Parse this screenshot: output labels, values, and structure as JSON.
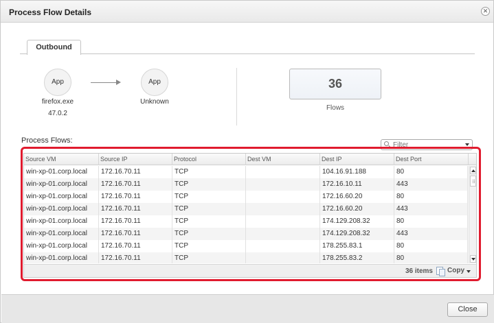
{
  "dialog": {
    "title": "Process Flow Details",
    "close_icon": "close-x-icon"
  },
  "tabs": [
    {
      "label": "Outbound",
      "selected": true
    }
  ],
  "flow": {
    "source": {
      "icon_label": "App",
      "name": "firefox.exe",
      "version": "47.0.2"
    },
    "destination": {
      "icon_label": "App",
      "name": "Unknown"
    }
  },
  "flows_summary": {
    "count": "36",
    "label": "Flows"
  },
  "process_flows": {
    "label": "Process Flows:",
    "filter_placeholder": "Filter",
    "columns": [
      "Source VM",
      "Source IP",
      "Protocol",
      "Dest VM",
      "Dest IP",
      "Dest Port"
    ],
    "rows": [
      [
        "win-xp-01.corp.local",
        "172.16.70.11",
        "TCP",
        "",
        "104.16.91.188",
        "80"
      ],
      [
        "win-xp-01.corp.local",
        "172.16.70.11",
        "TCP",
        "",
        "172.16.10.11",
        "443"
      ],
      [
        "win-xp-01.corp.local",
        "172.16.70.11",
        "TCP",
        "",
        "172.16.60.20",
        "80"
      ],
      [
        "win-xp-01.corp.local",
        "172.16.70.11",
        "TCP",
        "",
        "172.16.60.20",
        "443"
      ],
      [
        "win-xp-01.corp.local",
        "172.16.70.11",
        "TCP",
        "",
        "174.129.208.32",
        "80"
      ],
      [
        "win-xp-01.corp.local",
        "172.16.70.11",
        "TCP",
        "",
        "174.129.208.32",
        "443"
      ],
      [
        "win-xp-01.corp.local",
        "172.16.70.11",
        "TCP",
        "",
        "178.255.83.1",
        "80"
      ],
      [
        "win-xp-01.corp.local",
        "172.16.70.11",
        "TCP",
        "",
        "178.255.83.2",
        "80"
      ]
    ],
    "items_count": "36 items",
    "copy_label": "Copy"
  },
  "footer": {
    "close_label": "Close"
  },
  "colors": {
    "highlight": "#e01b2e"
  }
}
